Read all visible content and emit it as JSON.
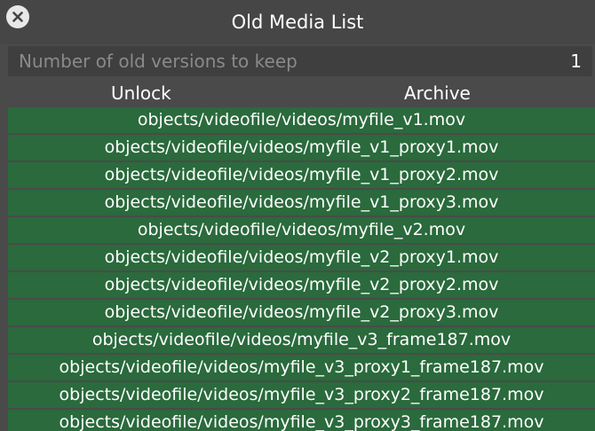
{
  "window": {
    "title": "Old Media List",
    "close_icon": "close-icon"
  },
  "settings": {
    "label": "Number of old versions to keep",
    "value": "1"
  },
  "columns": {
    "unlock": "Unlock",
    "archive": "Archive"
  },
  "files": [
    "objects/videofile/videos/myfile_v1.mov",
    "objects/videofile/videos/myfile_v1_proxy1.mov",
    "objects/videofile/videos/myfile_v1_proxy2.mov",
    "objects/videofile/videos/myfile_v1_proxy3.mov",
    "objects/videofile/videos/myfile_v2.mov",
    "objects/videofile/videos/myfile_v2_proxy1.mov",
    "objects/videofile/videos/myfile_v2_proxy2.mov",
    "objects/videofile/videos/myfile_v2_proxy3.mov",
    "objects/videofile/videos/myfile_v3_frame187.mov",
    "objects/videofile/videos/myfile_v3_proxy1_frame187.mov",
    "objects/videofile/videos/myfile_v3_proxy2_frame187.mov",
    "objects/videofile/videos/myfile_v3_proxy3_frame187.mov"
  ],
  "colors": {
    "row_green": "#2a6a3c",
    "background": "#4a4a4a",
    "text": "#ffffff",
    "muted_text": "#8a8a8a"
  }
}
